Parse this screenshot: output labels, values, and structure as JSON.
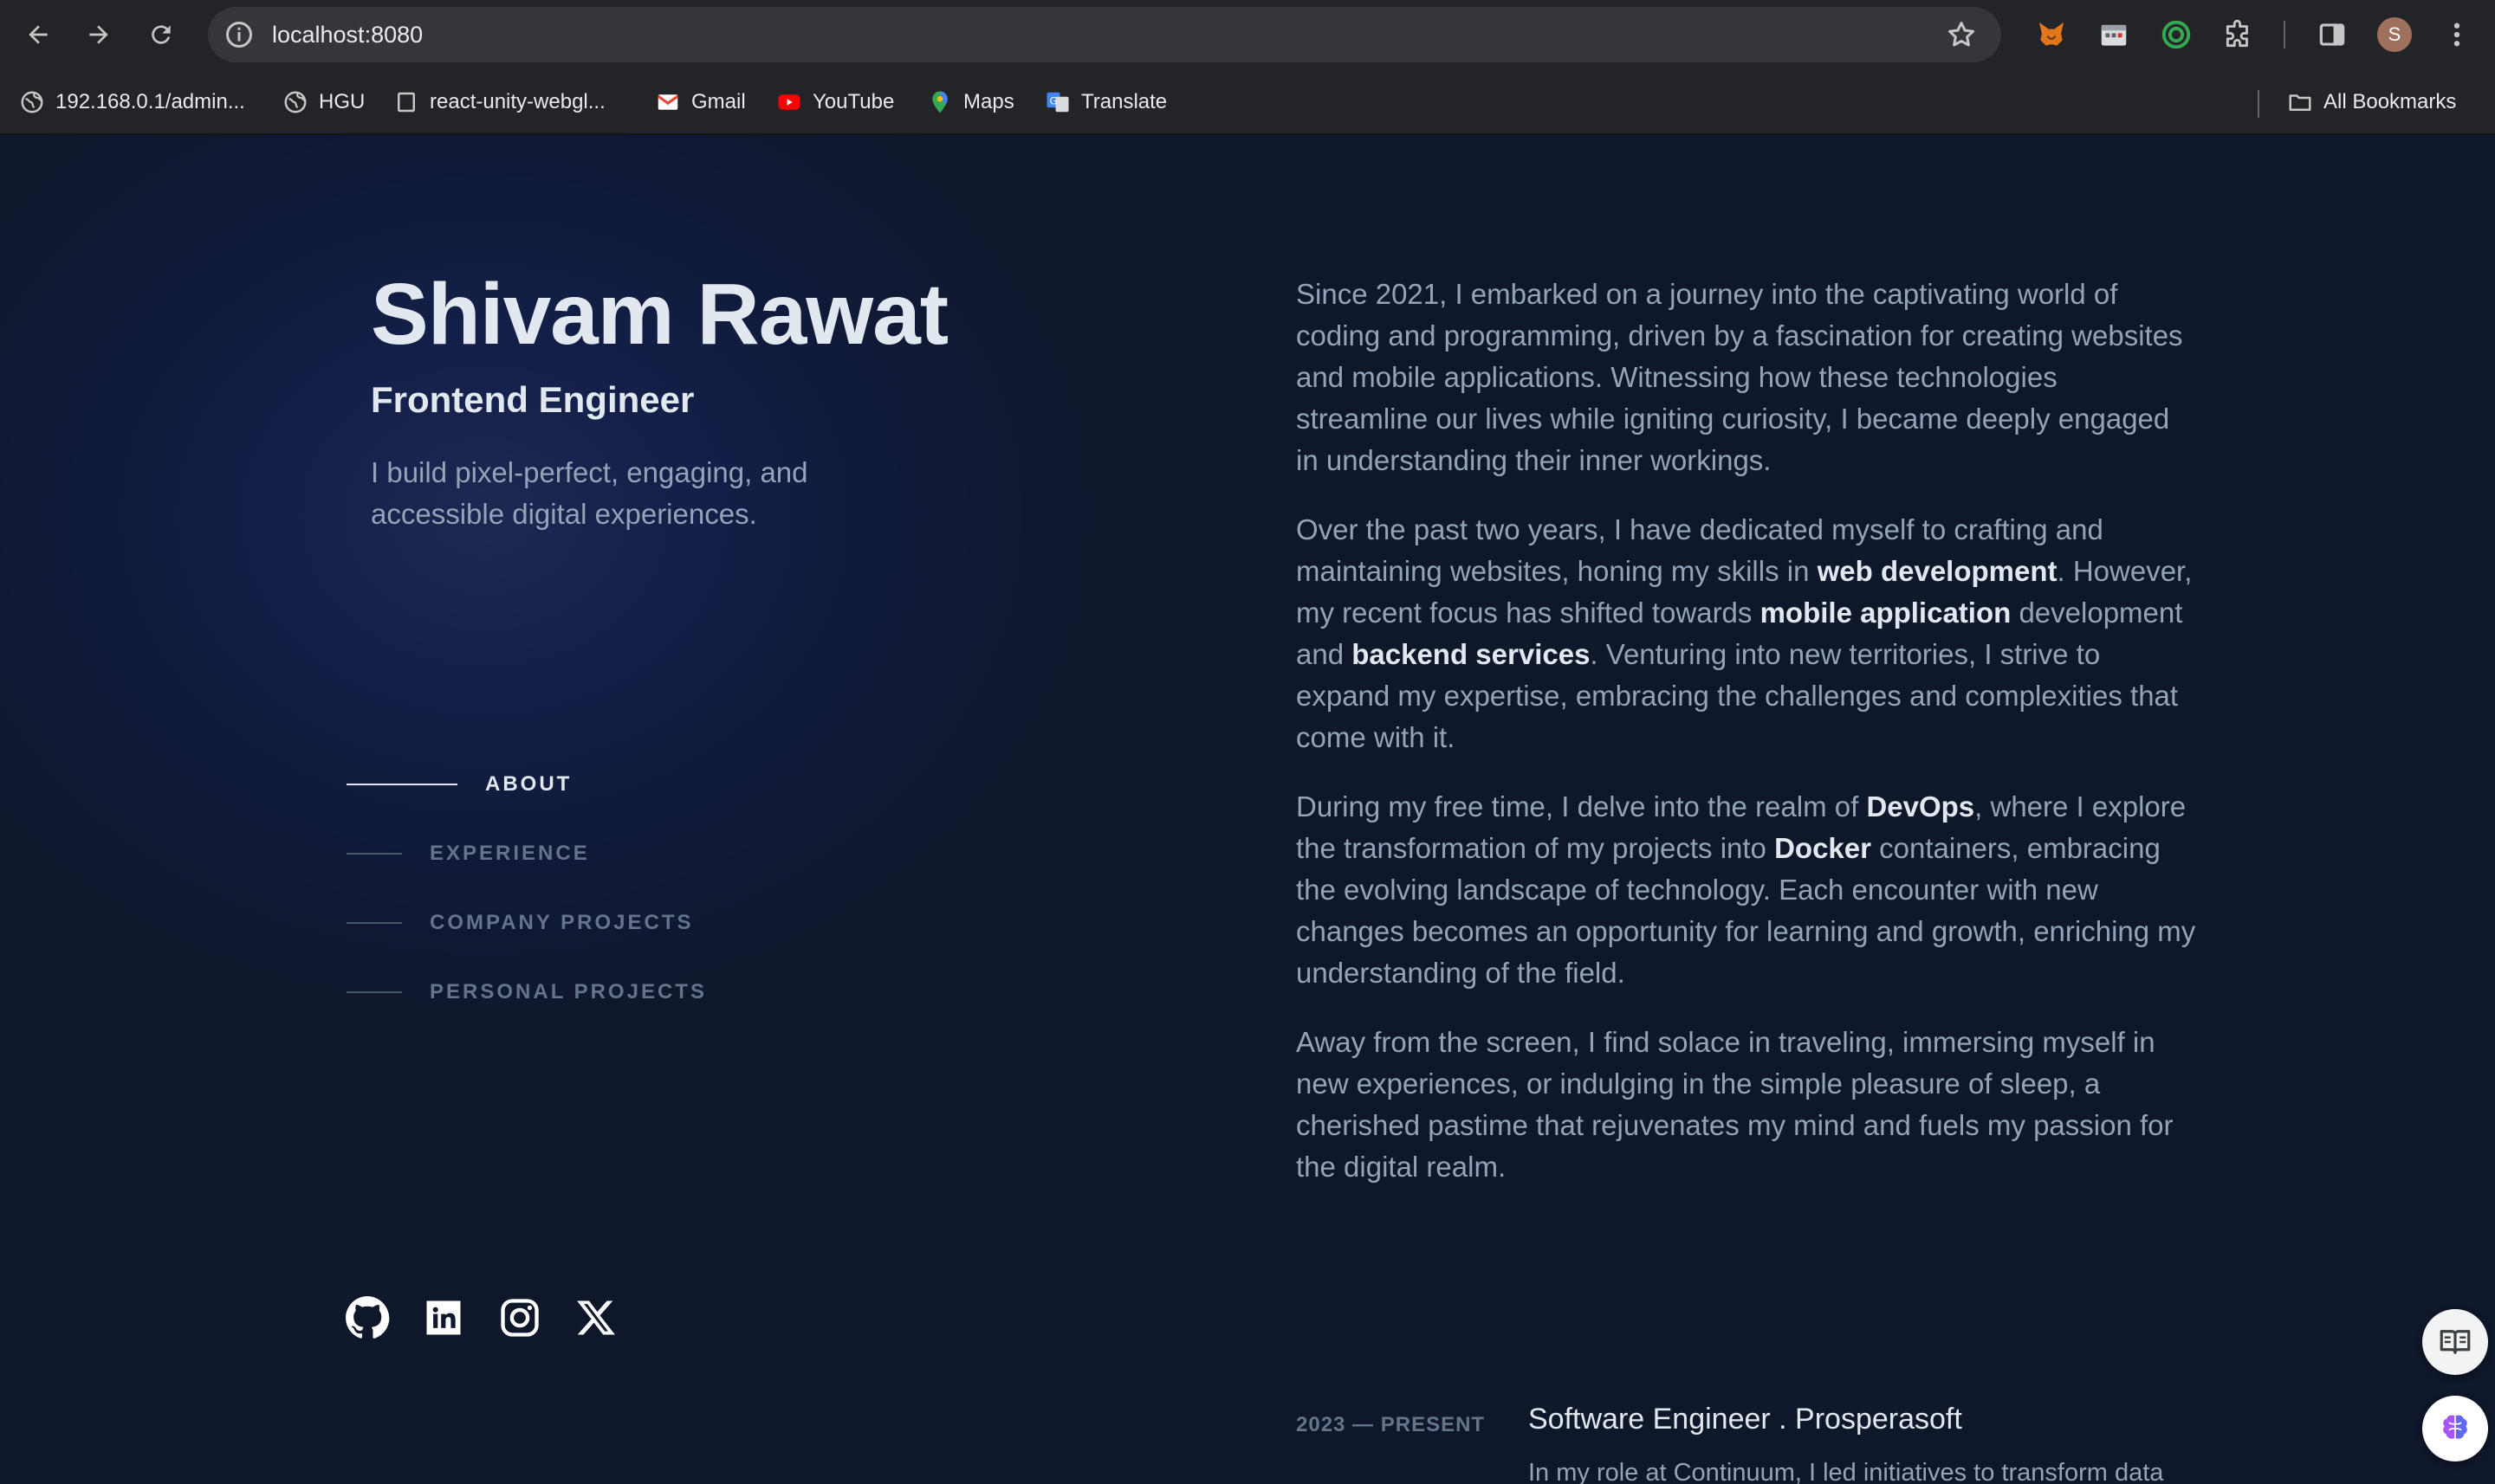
{
  "browser": {
    "url": "localhost:8080",
    "profile_initial": "S",
    "bookmarks": [
      {
        "label": "192.168.0.1/admin...",
        "icon": "globe-icon"
      },
      {
        "label": "HGU",
        "icon": "globe-icon"
      },
      {
        "label": "react-unity-webgl...",
        "icon": "page-icon"
      },
      {
        "label": "Gmail",
        "icon": "gmail-icon"
      },
      {
        "label": "YouTube",
        "icon": "youtube-icon"
      },
      {
        "label": "Maps",
        "icon": "maps-icon"
      },
      {
        "label": "Translate",
        "icon": "translate-icon"
      }
    ],
    "all_bookmarks": "All Bookmarks"
  },
  "hero": {
    "name": "Shivam Rawat",
    "role": "Frontend Engineer",
    "tagline": "I build pixel-perfect, engaging, and accessible digital experiences."
  },
  "nav": {
    "items": [
      {
        "label": "ABOUT",
        "active": true
      },
      {
        "label": "EXPERIENCE",
        "active": false
      },
      {
        "label": "COMPANY PROJECTS",
        "active": false
      },
      {
        "label": "PERSONAL PROJECTS",
        "active": false
      }
    ]
  },
  "socials": [
    "github-icon",
    "linkedin-icon",
    "instagram-icon",
    "x-icon"
  ],
  "about": {
    "p1": "Since 2021, I embarked on a journey into the captivating world of coding and programming, driven by a fascination for creating websites and mobile applications. Witnessing how these technologies streamline our lives while igniting curiosity, I became deeply engaged in understanding their inner workings.",
    "p2": {
      "a": "Over the past two years, I have dedicated myself to crafting and maintaining websites, honing my skills in ",
      "b": "web development",
      "c": ". However, my recent focus has shifted towards ",
      "d": "mobile application",
      "e": " development and ",
      "f": "backend services",
      "g": ". Venturing into new territories, I strive to expand my expertise, embracing the challenges and complexities that come with it."
    },
    "p3": {
      "a": "During my free time, I delve into the realm of ",
      "b": "DevOps",
      "c": ", where I explore the transformation of my projects into ",
      "d": "Docker",
      "e": " containers, embracing the evolving landscape of technology. Each encounter with new changes becomes an opportunity for learning and growth, enriching my understanding of the field."
    },
    "p4": "Away from the screen, I find solace in traveling, immersing myself in new experiences, or indulging in the simple pleasure of sleep, a cherished pastime that rejuvenates my mind and fuels my passion for the digital realm."
  },
  "experience": {
    "date": "2023 — PRESENT",
    "title": "Software Engineer . Prosperasoft",
    "desc": "In my role at Continuum, I led initiatives to transform data"
  },
  "colors": {
    "background": "#0f172a",
    "heading": "#e2e8f0",
    "body_text": "#94a3b8",
    "muted": "#64748b"
  }
}
